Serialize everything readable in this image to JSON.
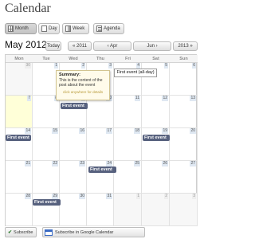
{
  "page": {
    "title": "Calendar"
  },
  "views": [
    {
      "label": "Month",
      "icon": "month-view-icon",
      "active": true
    },
    {
      "label": "Day",
      "icon": "day-view-icon",
      "active": false
    },
    {
      "label": "Week",
      "icon": "week-view-icon",
      "active": false
    },
    {
      "label": "Agenda",
      "icon": "agenda-view-icon",
      "active": false
    }
  ],
  "nav": {
    "month_title": "May 2012",
    "today_label": "Today",
    "prev_year_label": "« 2011",
    "prev_month_label": "‹ Apr",
    "next_month_label": "Jun ›",
    "next_year_label": "2013 »"
  },
  "calendar": {
    "weekdays": [
      "Mon",
      "Tue",
      "Wed",
      "Thu",
      "Fri",
      "Sat",
      "Sun"
    ],
    "weeks": [
      [
        "30",
        "1",
        "2",
        "3",
        "4",
        "5",
        "6"
      ],
      [
        "7",
        "8",
        "9",
        "10",
        "11",
        "12",
        "13"
      ],
      [
        "14",
        "15",
        "16",
        "17",
        "18",
        "19",
        "20"
      ],
      [
        "21",
        "22",
        "23",
        "24",
        "25",
        "26",
        "27"
      ],
      [
        "28",
        "29",
        "30",
        "31",
        "1",
        "2",
        "3"
      ]
    ],
    "today": "7"
  },
  "events": {
    "first_event_label": "First event",
    "allday_tooltip": "First event (all-day)"
  },
  "popover": {
    "title": "Summary:",
    "text": "This is the content of the post about the event",
    "link": "click anywhere for details"
  },
  "footer": {
    "subscribe_label": "Subscribe",
    "google_label": "Subscribe in Google Calendar"
  },
  "colors": {
    "event_bg": "#57617e",
    "today_bg": "#ffffd8",
    "day_number_bg": "#dfe8f2"
  }
}
